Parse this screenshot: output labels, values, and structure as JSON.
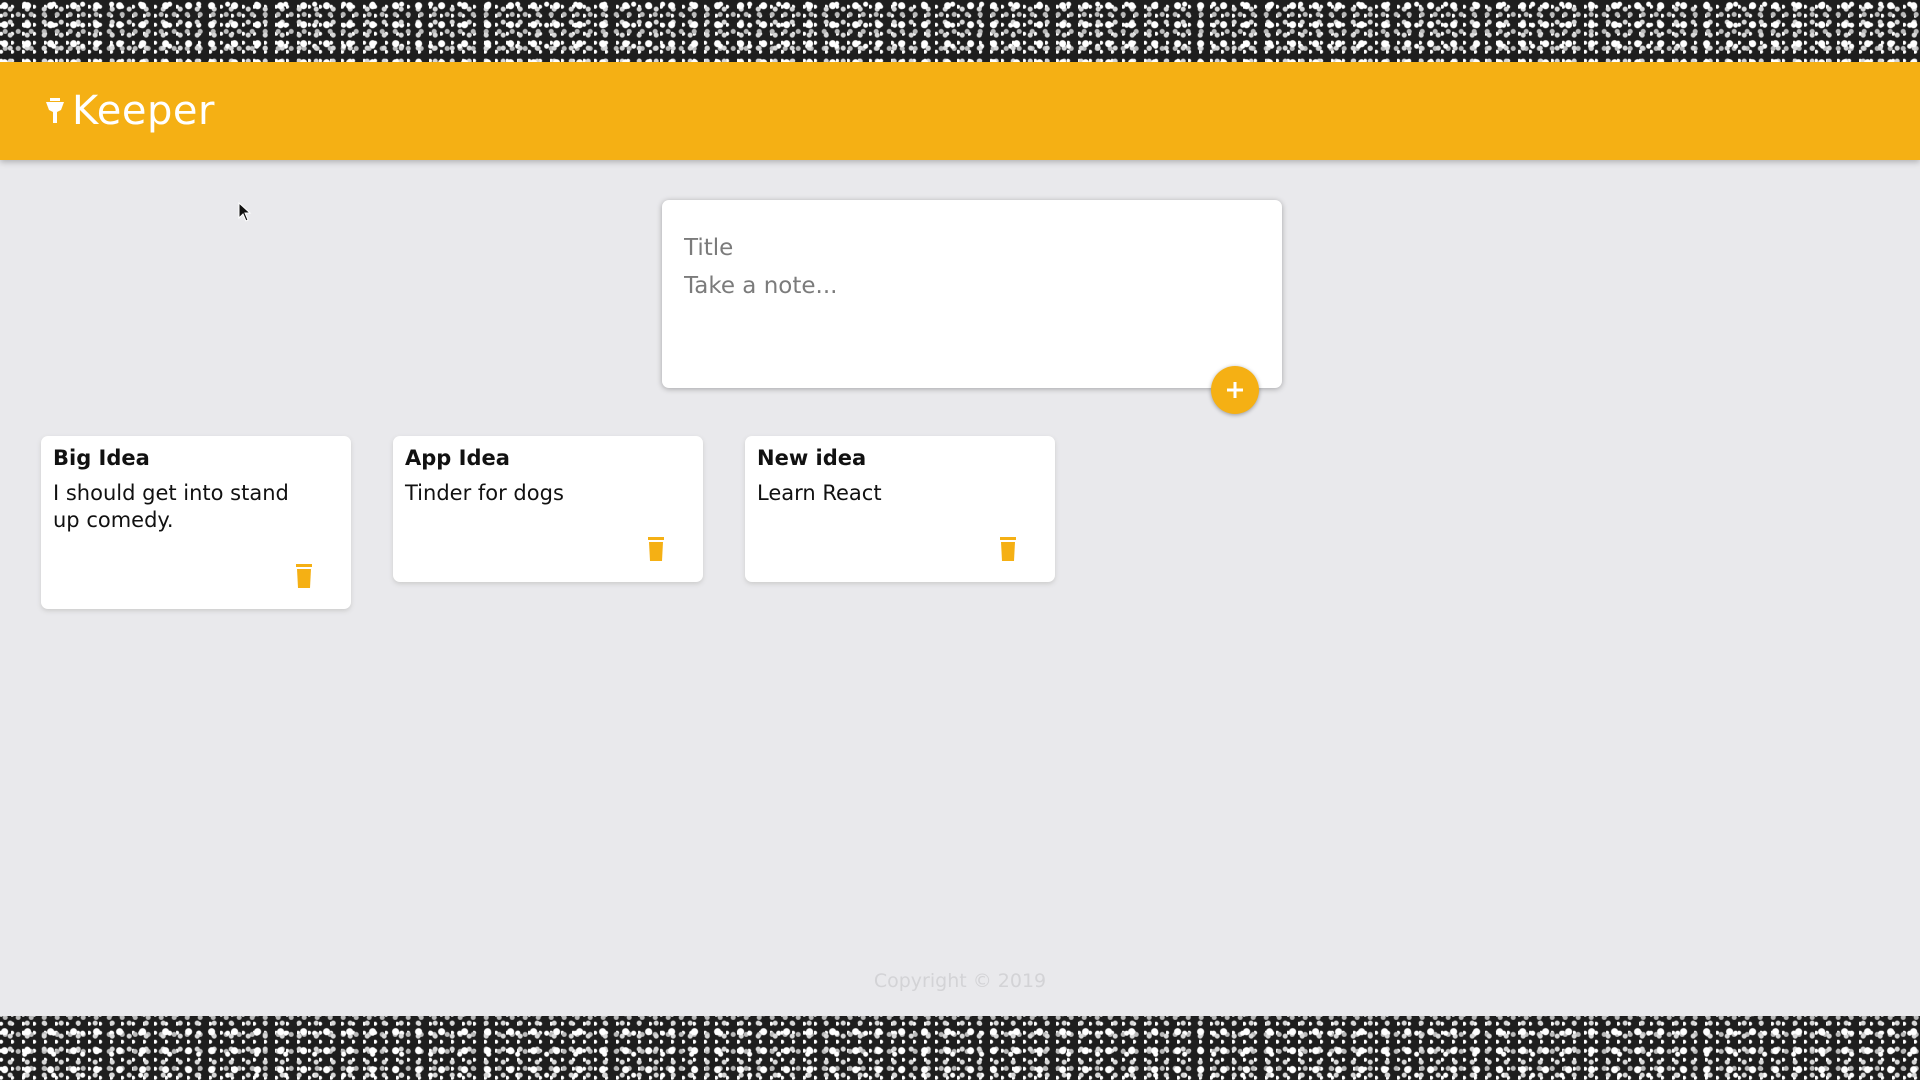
{
  "app": {
    "title": "Keeper",
    "brand_color": "#f5b014",
    "logo_icon": "highlighter-icon"
  },
  "create_area": {
    "title_placeholder": "Title",
    "content_placeholder": "Take a note...",
    "add_icon": "plus-icon"
  },
  "notes": [
    {
      "title": "Big Idea",
      "content": "I should get into stand\nup comedy.",
      "delete_icon": "delete-icon"
    },
    {
      "title": "App Idea",
      "content": "Tinder for dogs",
      "delete_icon": "delete-icon"
    },
    {
      "title": "New idea",
      "content": "Learn React",
      "delete_icon": "delete-icon"
    }
  ],
  "footer": {
    "copyright": "Copyright © 2019"
  }
}
